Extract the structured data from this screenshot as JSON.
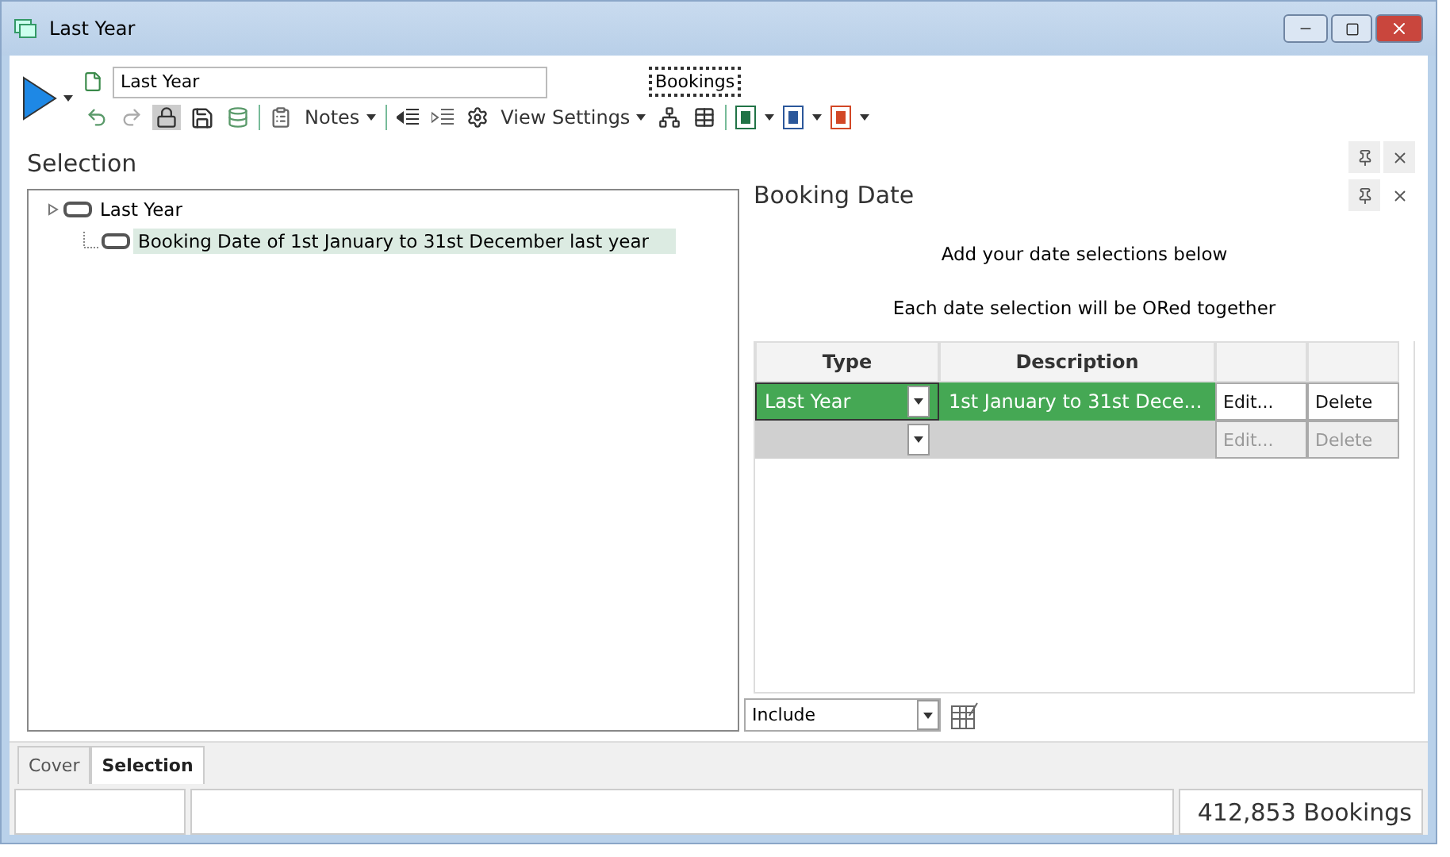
{
  "window": {
    "title": "Last Year"
  },
  "toolbar": {
    "name_field": "Last Year",
    "target": "Bookings",
    "notes": "Notes",
    "view_settings": "View Settings"
  },
  "selection_panel": {
    "title": "Selection",
    "tree": [
      {
        "label": "Last Year",
        "selected": false,
        "children": [
          {
            "label": "Booking Date of 1st January to 31st December last year",
            "selected": true
          }
        ]
      }
    ]
  },
  "detail_panel": {
    "title": "Booking Date",
    "instructions": [
      "Add your date selections below",
      "Each date selection will be ORed together"
    ],
    "grid": {
      "columns": [
        "Type",
        "Description"
      ],
      "rows": [
        {
          "type": "Last Year",
          "description": "1st January to 31st Dece...",
          "edit": "Edit...",
          "delete": "Delete",
          "disabled": false
        },
        {
          "type": "",
          "description": "",
          "edit": "Edit...",
          "delete": "Delete",
          "disabled": true
        }
      ]
    },
    "mode": "Include"
  },
  "tabs": [
    {
      "label": "Cover",
      "selected": false
    },
    {
      "label": "Selection",
      "selected": true
    }
  ],
  "status_bar": {
    "count": "412,853 Bookings"
  }
}
